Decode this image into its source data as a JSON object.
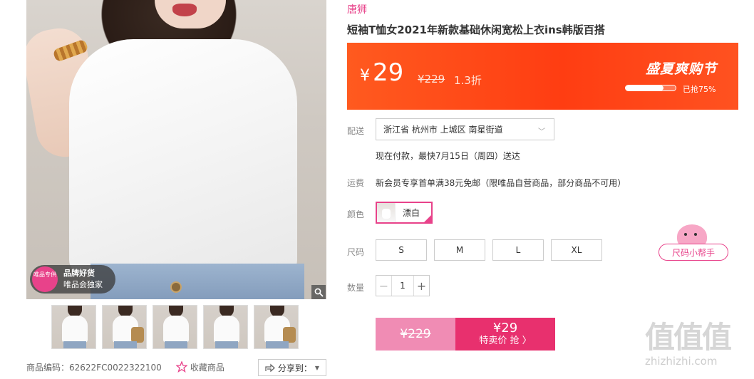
{
  "gallery": {
    "badge": {
      "circle_text": "唯品专供",
      "line1": "品牌好货",
      "line2": "唯品会独家"
    },
    "thumbnail_count": 5
  },
  "meta": {
    "product_code": "商品编码：62622FC0022322100",
    "favorite_label": "收藏商品",
    "share_label": "分享到："
  },
  "product": {
    "brand": "唐狮",
    "title": "短袖T恤女2021年新款基础休闲宽松上衣ins韩版百搭"
  },
  "price": {
    "currency": "¥",
    "current": "29",
    "original": "¥229",
    "discount": "1.3折",
    "festival": "盛夏爽购节",
    "sold_text": "已抢75%",
    "sold_fraction": 0.75
  },
  "delivery": {
    "label": "配送",
    "address": "浙江省 杭州市 上城区 南星街道",
    "eta": "现在付款，最快7月15日（周四）送达"
  },
  "shipping": {
    "label": "运费",
    "text": "新会员专享首单满38元免邮（限唯品自营商品，部分商品不可用）"
  },
  "color": {
    "label": "颜色",
    "options": [
      {
        "name": "漂白",
        "selected": true
      }
    ]
  },
  "size": {
    "label": "尺码",
    "options": [
      "S",
      "M",
      "L",
      "XL"
    ],
    "helper": "尺码小帮手"
  },
  "quantity": {
    "label": "数量",
    "value": "1",
    "minus": "−",
    "plus": "+"
  },
  "buy": {
    "original": "¥229",
    "sale_price": "¥29",
    "sale_label": "特卖价 抢 〉"
  },
  "watermark": {
    "big": "值值值",
    "small": "zhizhizhi.com"
  },
  "colors": {
    "accent": "#e8428a",
    "banner": "#ff3d12",
    "buy": "#e8306e"
  }
}
